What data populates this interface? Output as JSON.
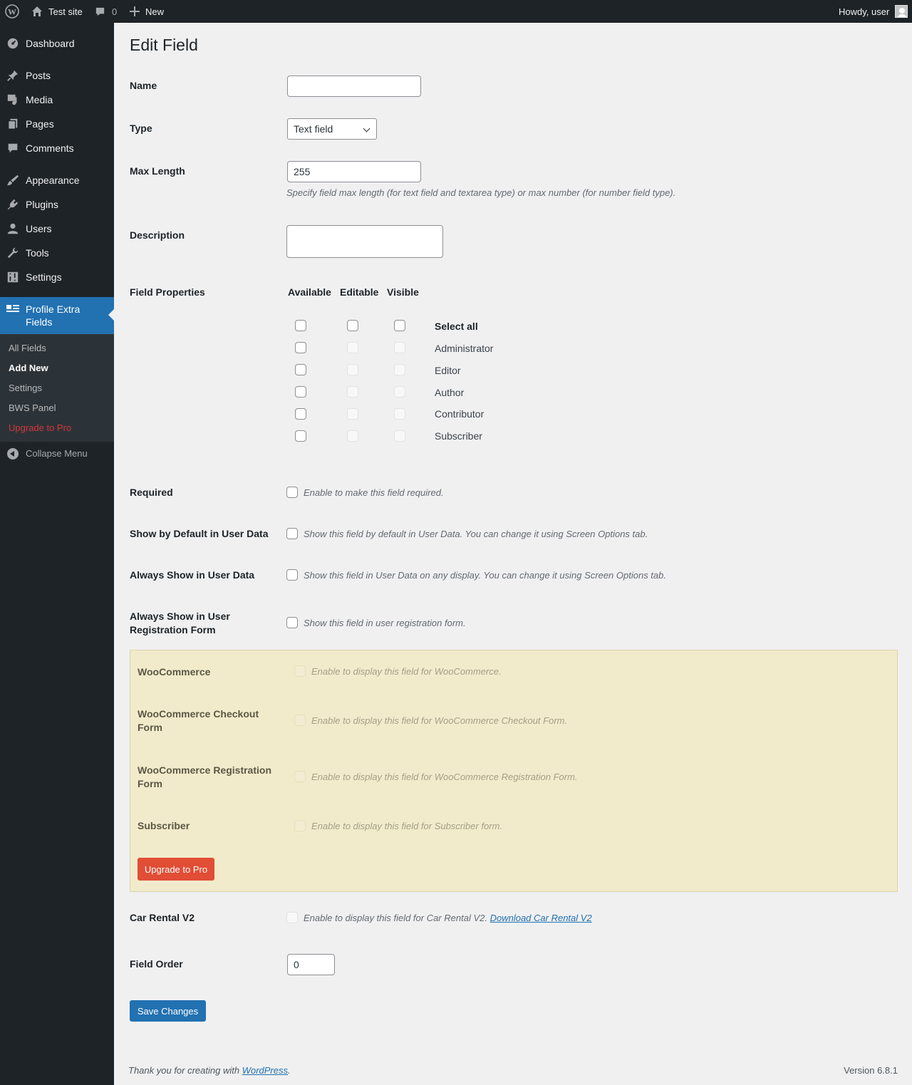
{
  "adminbar": {
    "site_name": "Test site",
    "comments_count": "0",
    "new_label": "New",
    "greeting": "Howdy, user"
  },
  "sidebar": {
    "items": [
      {
        "label": "Dashboard",
        "icon": "dashboard-icon"
      },
      {
        "label": "Posts",
        "icon": "pin-icon"
      },
      {
        "label": "Media",
        "icon": "media-icon"
      },
      {
        "label": "Pages",
        "icon": "pages-icon"
      },
      {
        "label": "Comments",
        "icon": "comment-icon"
      },
      {
        "label": "Appearance",
        "icon": "brush-icon"
      },
      {
        "label": "Plugins",
        "icon": "plug-icon"
      },
      {
        "label": "Users",
        "icon": "user-icon"
      },
      {
        "label": "Tools",
        "icon": "wrench-icon"
      },
      {
        "label": "Settings",
        "icon": "sliders-icon"
      }
    ],
    "active": {
      "label": "Profile Extra Fields",
      "icon": "id-card-icon"
    },
    "submenu": [
      {
        "label": "All Fields"
      },
      {
        "label": "Add New",
        "current": true
      },
      {
        "label": "Settings"
      },
      {
        "label": "BWS Panel"
      },
      {
        "label": "Upgrade to Pro"
      }
    ],
    "collapse_label": "Collapse Menu"
  },
  "page": {
    "title": "Edit Field",
    "name": {
      "label": "Name",
      "value": ""
    },
    "type": {
      "label": "Type",
      "value": "Text field"
    },
    "max_length": {
      "label": "Max Length",
      "value": "255",
      "description": "Specify field max length (for text field and textarea type) or max number (for number field type)."
    },
    "description": {
      "label": "Description",
      "value": ""
    },
    "field_properties": {
      "label": "Field Properties",
      "columns": [
        "Available",
        "Editable",
        "Visible"
      ],
      "roles": [
        "Select all",
        "Administrator",
        "Editor",
        "Author",
        "Contributor",
        "Subscriber"
      ]
    },
    "required": {
      "label": "Required",
      "description": "Enable to make this field required."
    },
    "show_default": {
      "label": "Show by Default in User Data",
      "description": "Show this field by default in User Data. You can change it using Screen Options tab."
    },
    "always_show": {
      "label": "Always Show in User Data",
      "description": "Show this field in User Data on any display. You can change it using Screen Options tab."
    },
    "always_show_reg": {
      "label": "Always Show in User Registration Form",
      "description": "Show this field in user registration form."
    },
    "pro_box": {
      "rows": [
        {
          "label": "WooCommerce",
          "description": "Enable to display this field for WooCommerce."
        },
        {
          "label": "WooCommerce Checkout Form",
          "description": "Enable to display this field for WooCommerce Checkout Form."
        },
        {
          "label": "WooCommerce Registration Form",
          "description": "Enable to display this field for WooCommerce Registration Form."
        },
        {
          "label": "Subscriber",
          "description": "Enable to display this field for Subscriber form."
        }
      ],
      "button": "Upgrade to Pro"
    },
    "car_rental": {
      "label": "Car Rental V2",
      "description": "Enable to display this field for Car Rental V2.",
      "link": "Download Car Rental V2"
    },
    "field_order": {
      "label": "Field Order",
      "value": "0"
    },
    "save_button": "Save Changes"
  },
  "footer": {
    "thanks_prefix": "Thank you for creating with",
    "thanks_link": "WordPress",
    "thanks_suffix": ".",
    "version": "Version 6.8.1"
  }
}
